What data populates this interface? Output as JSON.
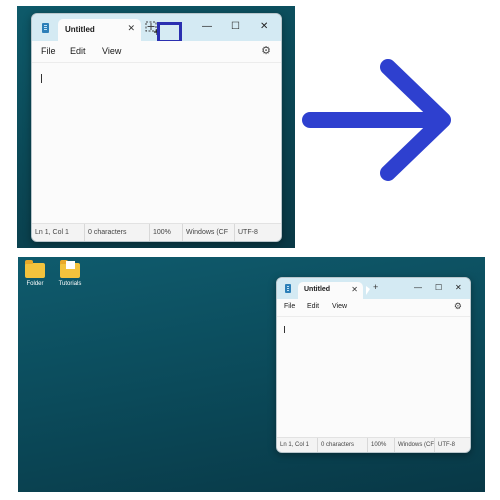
{
  "before": {
    "window": {
      "tab_title": "Untitled",
      "tab_close": "✕",
      "window_controls": {
        "minimize": "—",
        "maximize": "☐",
        "close": "✕"
      },
      "menus": [
        "File",
        "Edit",
        "View"
      ],
      "status": {
        "position": "Ln 1, Col 1",
        "characters": "0 characters",
        "zoom": "100%",
        "line_ending": "Windows (CF",
        "encoding": "UTF-8"
      }
    },
    "highlight_color": "#2a2fb0"
  },
  "arrow_color": "#2e40cf",
  "after": {
    "desktop_icons": [
      {
        "label": "Folder",
        "icon": "folder-icon"
      },
      {
        "label": "Tutorials",
        "icon": "folder-icon"
      }
    ],
    "window": {
      "tab_title": "Untitled",
      "tab_close": "✕",
      "new_tab": "+",
      "window_controls": {
        "minimize": "—",
        "maximize": "☐",
        "close": "✕"
      },
      "menus": [
        "File",
        "Edit",
        "View"
      ],
      "status": {
        "position": "Ln 1, Col 1",
        "characters": "0 characters",
        "zoom": "100%",
        "line_ending": "Windows (CF",
        "encoding": "UTF-8"
      }
    }
  }
}
